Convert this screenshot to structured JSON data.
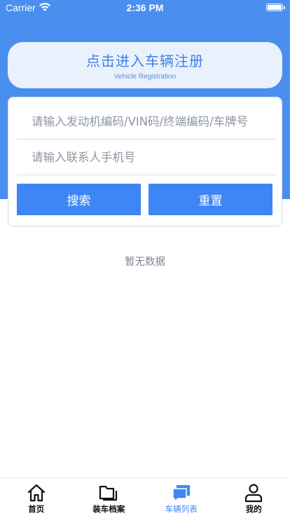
{
  "status_bar": {
    "carrier": "Carrier",
    "time": "2:36 PM"
  },
  "registration": {
    "title": "点击进入车辆注册",
    "subtitle": "Vehicle Registration"
  },
  "search": {
    "code_placeholder": "请输入发动机编码/VIN码/终端编码/车牌号",
    "phone_placeholder": "请输入联系人手机号",
    "code_value": "",
    "phone_value": "",
    "search_label": "搜索",
    "reset_label": "重置"
  },
  "empty_message": "暂无数据",
  "tabbar": {
    "active_index": 2,
    "items": [
      {
        "label": "首页",
        "icon": "home-icon"
      },
      {
        "label": "装车档案",
        "icon": "folder-icon"
      },
      {
        "label": "车辆列表",
        "icon": "chat-list-icon"
      },
      {
        "label": "我的",
        "icon": "person-icon"
      }
    ]
  },
  "colors": {
    "header_blue": "#4a8ff0",
    "button_blue": "#3f86f5",
    "active_tab": "#3f86f5",
    "registration_bg": "#e9f1fd"
  }
}
